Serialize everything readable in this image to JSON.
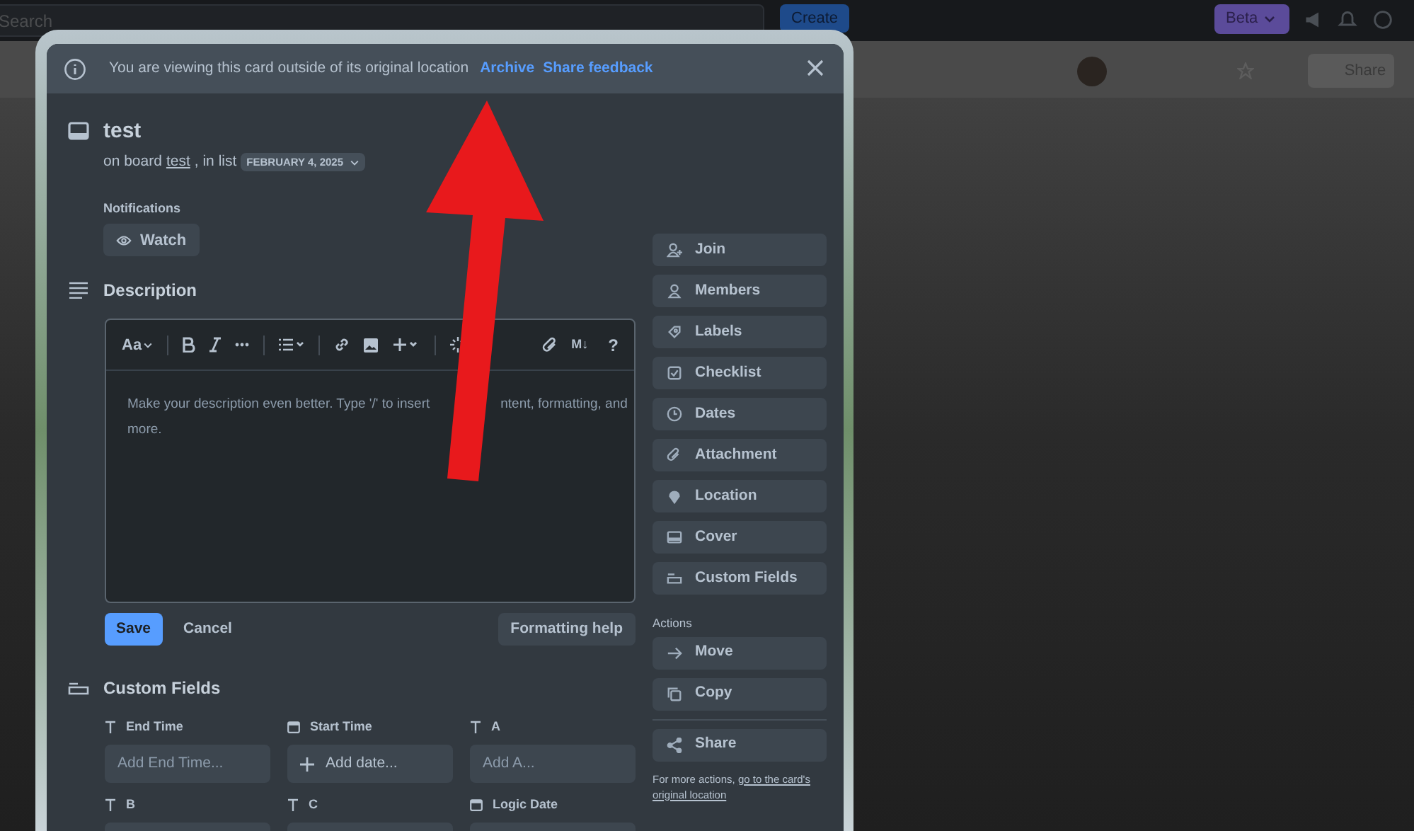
{
  "top_bar": {
    "search_placeholder": "Search",
    "create": "Create",
    "beta": "Beta"
  },
  "board_header": {
    "share": "Share"
  },
  "banner": {
    "message": "You are viewing this card outside of its original location",
    "links": [
      "Archive",
      "Share feedback"
    ]
  },
  "card": {
    "title": "test",
    "location": {
      "prefix": "on board",
      "board": "test",
      "middle": ", in list",
      "list": "FEBRUARY 4, 2025"
    }
  },
  "notifications": {
    "label": "Notifications",
    "watch": "Watch"
  },
  "description": {
    "heading": "Description",
    "toolbar": {
      "text_style": "Aa",
      "markdown": "M↓",
      "help": "?"
    },
    "placeholder": [
      "Make your description even better. Type '/' to insert",
      "ntent, formatting, and",
      "more."
    ],
    "buttons": {
      "save": "Save",
      "cancel": "Cancel",
      "help": "Formatting help"
    }
  },
  "custom_fields": {
    "heading": "Custom Fields",
    "fields": [
      {
        "label": "End Time",
        "kind": "text",
        "placeholder": "Add End Time..."
      },
      {
        "label": "Start Time",
        "kind": "date",
        "placeholder": "Add date..."
      },
      {
        "label": "A",
        "kind": "text",
        "placeholder": "Add A..."
      },
      {
        "label": "B",
        "kind": "text"
      },
      {
        "label": "C",
        "kind": "text"
      },
      {
        "label": "Logic Date",
        "kind": "date"
      }
    ]
  },
  "sidebar": {
    "items": [
      "Join",
      "Members",
      "Labels",
      "Checklist",
      "Dates",
      "Attachment",
      "Location",
      "Cover",
      "Custom Fields"
    ],
    "actions_label": "Actions",
    "actions": [
      "Move",
      "Copy"
    ],
    "share": "Share",
    "footer": "For more actions,",
    "footer_link": [
      "go to the card's",
      "original location"
    ]
  }
}
